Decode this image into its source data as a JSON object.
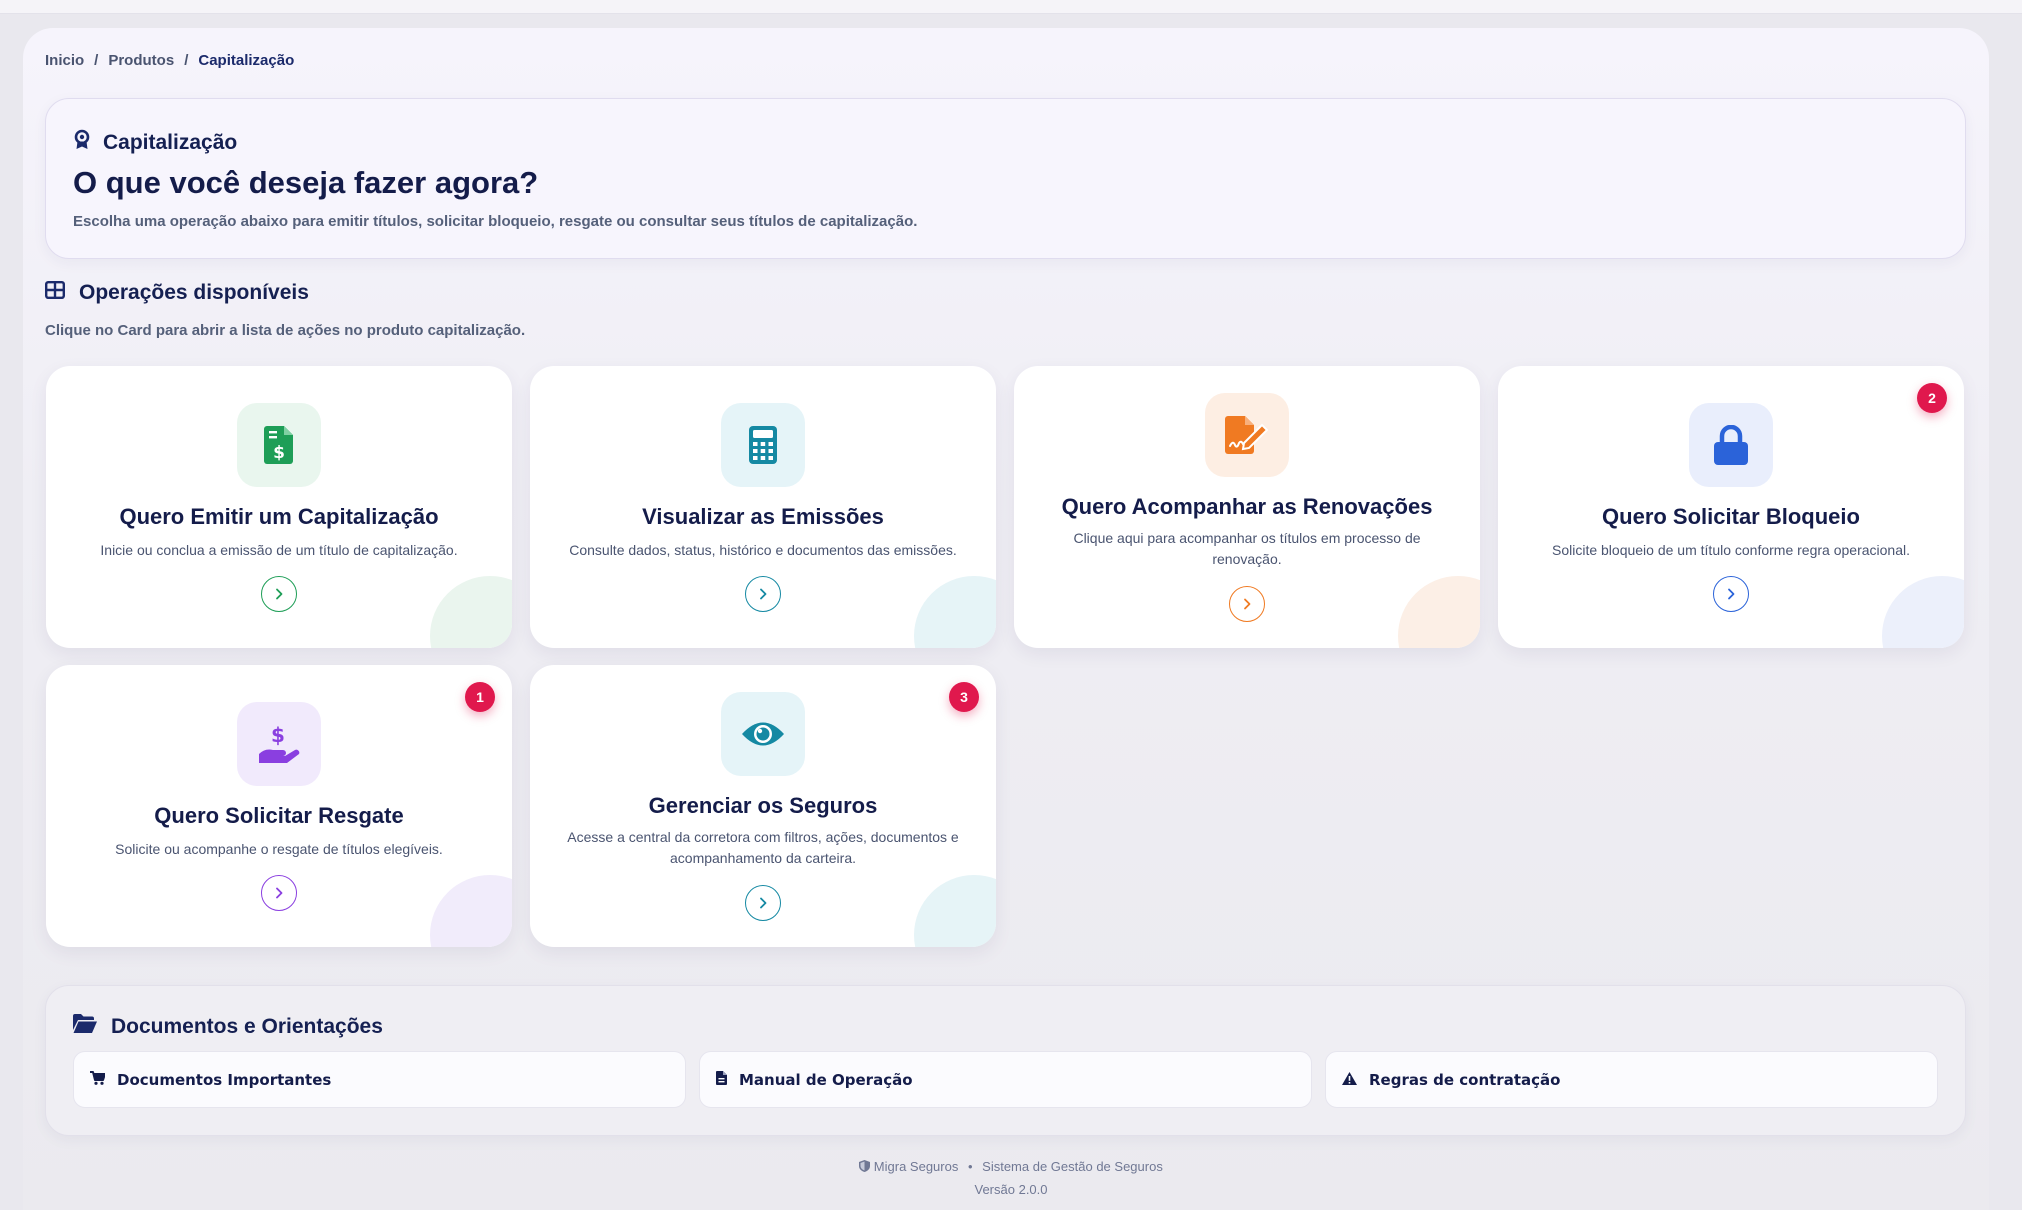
{
  "breadcrumb": {
    "items": [
      "Inicio",
      "Produtos"
    ],
    "current": "Capitalização",
    "separator": "/"
  },
  "hero": {
    "kicker": "Capitalização",
    "kicker_icon": "award-icon",
    "title": "O que você deseja fazer agora?",
    "description": "Escolha uma operação abaixo para emitir títulos, solicitar bloqueio, resgate ou consultar seus títulos de capitalização."
  },
  "operations": {
    "title": "Operações disponíveis",
    "title_icon": "grid-icon",
    "subtitle": "Clique no Card para abrir a lista de ações no produto capitalização.",
    "cards": [
      {
        "title": "Quero Emitir um Capitalização",
        "description": "Inicie ou conclua a emissão de um título de capitalização.",
        "icon": "file-dollar-icon",
        "accent": "#1e9e57",
        "tint": "#e9f6ee"
      },
      {
        "title": "Visualizar as Emissões",
        "description": "Consulte dados, status, histórico e documentos das emissões.",
        "icon": "calculator-icon",
        "accent": "#1589a3",
        "tint": "#e5f4f8"
      },
      {
        "title": "Quero Acompanhar as Renovações",
        "description": "Clique aqui para acompanhar os títulos em processo de renovação.",
        "icon": "file-signature-icon",
        "accent": "#f07a22",
        "tint": "#fdeee3"
      },
      {
        "title": "Quero Solicitar Bloqueio",
        "description": "Solicite bloqueio de um título conforme regra operacional.",
        "icon": "lock-icon",
        "accent": "#2b63d9",
        "tint": "#e9eefc",
        "badge": "2"
      },
      {
        "title": "Quero Solicitar Resgate",
        "description": "Solicite ou acompanhe o resgate de títulos elegíveis.",
        "icon": "hand-dollar-icon",
        "accent": "#8a3fe0",
        "tint": "#f1eafc",
        "badge": "1"
      },
      {
        "title": "Gerenciar os Seguros",
        "description": "Acesse a central da corretora com filtros, ações, documentos e acompanhamento da carteira.",
        "icon": "eye-icon",
        "accent": "#1589a3",
        "tint": "#e5f4f8",
        "badge": "3"
      }
    ]
  },
  "documents": {
    "title": "Documentos e Orientações",
    "title_icon": "folder-open-icon",
    "buttons": [
      {
        "label": "Documentos Importantes",
        "icon": "cart-icon"
      },
      {
        "label": "Manual de Operação",
        "icon": "file-icon"
      },
      {
        "label": "Regras de contratação",
        "icon": "warning-icon"
      }
    ]
  },
  "footer": {
    "brand": "Migra Seguros",
    "system": "Sistema de Gestão de Seguros",
    "version": "Versão 2.0.0",
    "separator": "•"
  }
}
